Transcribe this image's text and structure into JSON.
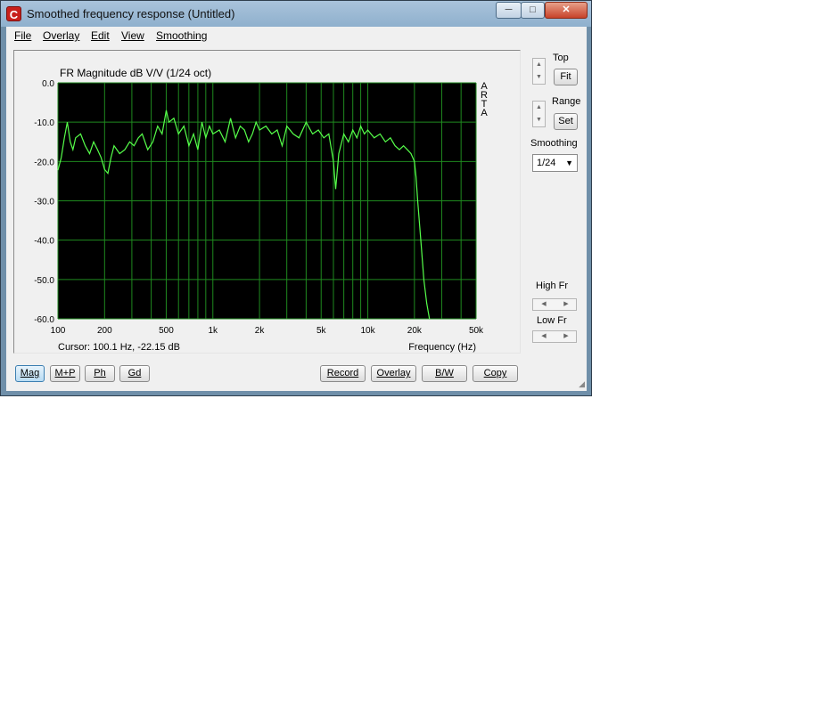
{
  "window": {
    "title": "Smoothed frequency response (Untitled)",
    "app_icon": "C",
    "min_glyph": "─",
    "max_glyph": "□",
    "close_glyph": "✕"
  },
  "menu": [
    "File",
    "Overlay",
    "Edit",
    "View",
    "Smoothing"
  ],
  "chart_data": {
    "type": "line",
    "title": "FR Magnitude dB V/V (1/24 oct)",
    "xlabel": "Frequency (Hz)",
    "ylabel": "",
    "x_scale": "log",
    "xlim": [
      100,
      50000
    ],
    "ylim": [
      -60,
      0
    ],
    "xticks": [
      100,
      200,
      500,
      1000,
      2000,
      5000,
      10000,
      20000,
      50000
    ],
    "xtick_labels": [
      "100",
      "200",
      "500",
      "1k",
      "2k",
      "5k",
      "10k",
      "20k",
      "50k"
    ],
    "yticks": [
      0,
      -10,
      -20,
      -30,
      -40,
      -50,
      -60
    ],
    "ytick_labels": [
      "0.0",
      "-10.0",
      "-20.0",
      "-30.0",
      "-40.0",
      "-50.0",
      "-60.0"
    ],
    "grid": true,
    "background": "#000000",
    "grid_color": "#1f8a1f",
    "line_color": "#56ff4a",
    "side_label": [
      "A",
      "R",
      "T",
      "A"
    ],
    "series": [
      {
        "x": [
          100,
          105,
          110,
          115,
          120,
          125,
          130,
          140,
          150,
          160,
          170,
          180,
          190,
          200,
          210,
          220,
          230,
          250,
          270,
          290,
          310,
          330,
          350,
          380,
          410,
          440,
          470,
          500,
          520,
          560,
          600,
          650,
          700,
          750,
          800,
          850,
          900,
          950,
          1000,
          1100,
          1200,
          1300,
          1400,
          1500,
          1600,
          1700,
          1800,
          1900,
          2000,
          2200,
          2400,
          2600,
          2800,
          3000,
          3300,
          3600,
          4000,
          4400,
          4800,
          5200,
          5600,
          6000,
          6200,
          6500,
          7000,
          7500,
          8000,
          8500,
          9000,
          9500,
          10000,
          11000,
          12000,
          13000,
          14000,
          15000,
          16000,
          17000,
          18000,
          19000,
          20000,
          20500,
          21000,
          22000,
          23000,
          24000,
          25000
        ],
        "y": [
          -22.2,
          -19,
          -14,
          -10,
          -15,
          -17,
          -14,
          -13,
          -16,
          -18,
          -15,
          -17,
          -19,
          -22,
          -23,
          -19,
          -16,
          -18,
          -17,
          -15,
          -16,
          -14,
          -13,
          -17,
          -15,
          -11,
          -13,
          -7,
          -10,
          -9,
          -13,
          -11,
          -16,
          -13,
          -17,
          -10,
          -14,
          -11,
          -13,
          -12,
          -15,
          -9,
          -14,
          -11,
          -12,
          -15,
          -13,
          -10,
          -12,
          -11,
          -13,
          -12,
          -16,
          -11,
          -13,
          -14,
          -10,
          -13,
          -12,
          -14,
          -13,
          -20,
          -27,
          -18,
          -13,
          -15,
          -12,
          -14,
          -11,
          -13,
          -12,
          -14,
          -13,
          -15,
          -14,
          -16,
          -17,
          -16,
          -17,
          -18,
          -20,
          -24,
          -30,
          -40,
          -50,
          -56,
          -60
        ]
      }
    ]
  },
  "cursor_text": "Cursor: 100.1 Hz, -22.15 dB",
  "right_panel": {
    "top_label": "Top",
    "fit_button": "Fit",
    "range_label": "Range",
    "set_button": "Set",
    "smoothing_label": "Smoothing",
    "smoothing_value": "1/24",
    "high_fr_label": "High Fr",
    "low_fr_label": "Low Fr",
    "spin_up": "▲",
    "spin_down": "▼",
    "left_glyph": "◀",
    "right_glyph": "▶",
    "dropdown_arrow": "▼"
  },
  "bottom_buttons": {
    "mag": "Mag",
    "mp": "M+P",
    "ph": "Ph",
    "gd": "Gd",
    "record": "Record",
    "overlay": "Overlay",
    "bw": "B/W",
    "copy": "Copy"
  }
}
